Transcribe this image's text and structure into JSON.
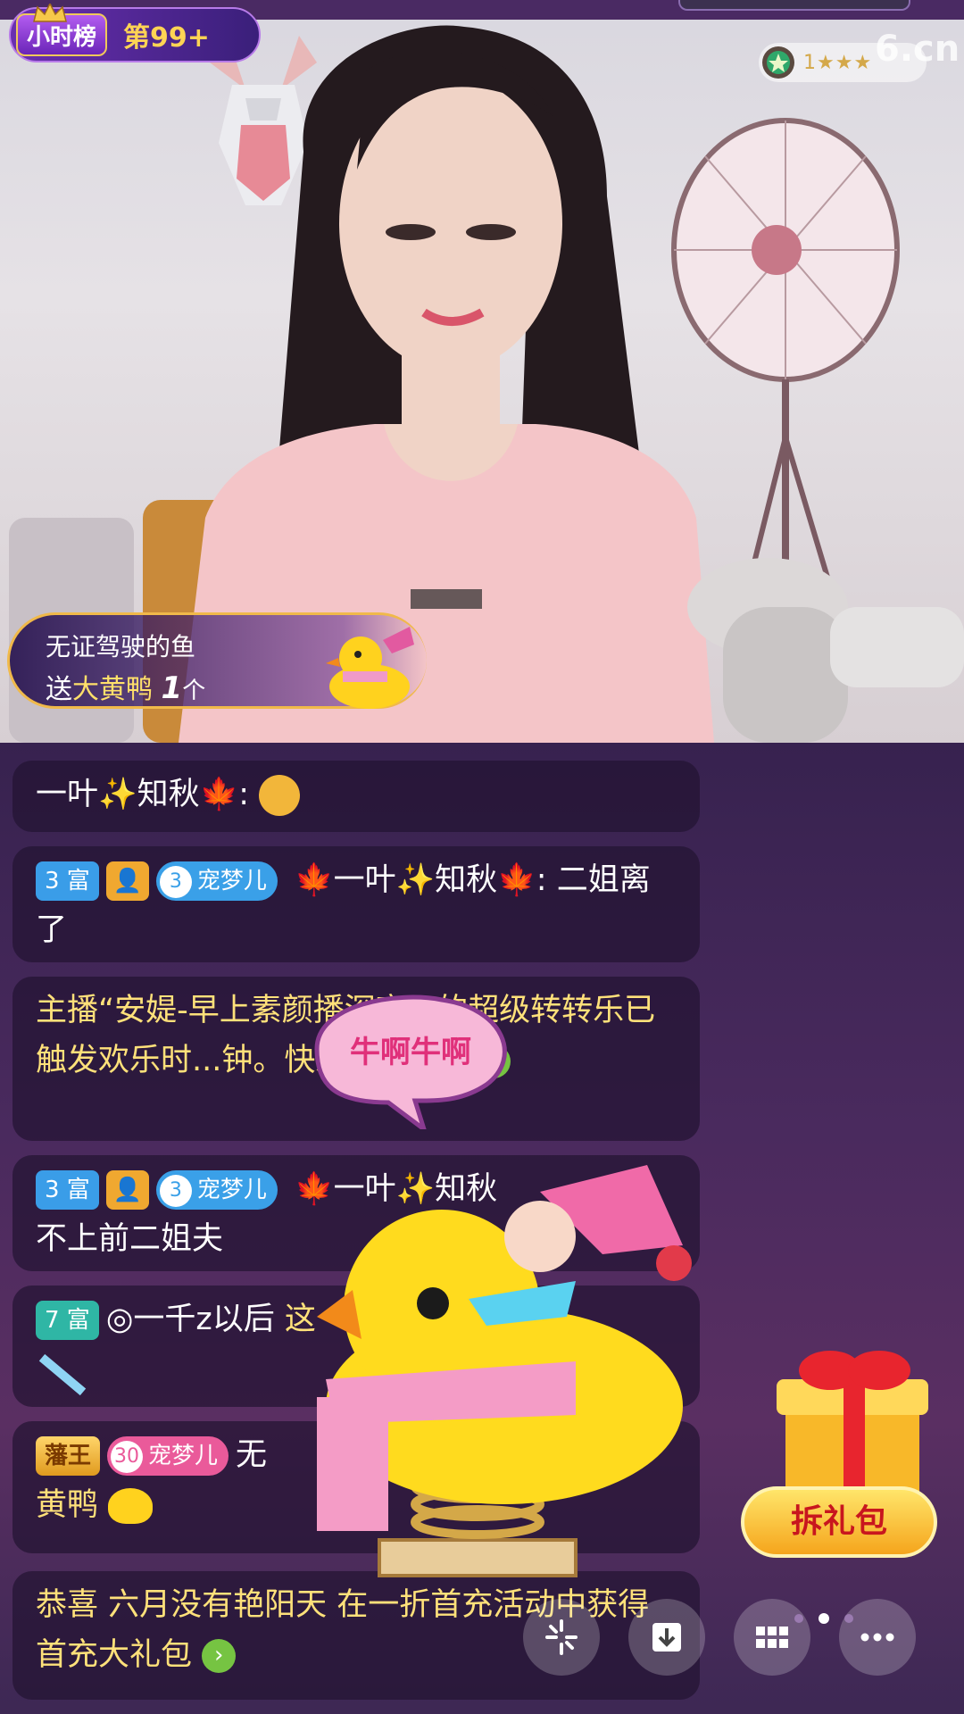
{
  "stream": {
    "hour_rank_label": "小时榜",
    "hour_rank_value": "第99+",
    "level_number": "1",
    "watermark": "6.cn"
  },
  "gift_banner": {
    "sender": "无证驾驶的鱼",
    "verb": "送",
    "gift_name": "大黄鸭",
    "count": "1",
    "unit": "个"
  },
  "chat": [
    {
      "user": "一叶",
      "user2": "知秋",
      "colon": ":"
    },
    {
      "rich": "3 富",
      "fan_level": "3",
      "fan_name": "宠梦儿",
      "user": "一叶",
      "user2": "知秋",
      "text": ": 二姐离了"
    },
    {
      "system": "主播“安媞-早上素颜播深夜...的超级转转乐已触发欢乐时...钟。快来参与吧~"
    },
    {
      "rich": "3 富",
      "fan_level": "3",
      "fan_name": "宠梦儿",
      "user": "一叶",
      "user2": "知秋",
      "text": "不上前二姐夫"
    },
    {
      "rich": "7 富",
      "user": "◎一千z以后",
      "text": "这"
    },
    {
      "lord": "藩王",
      "fan_level": "30",
      "fan_name": "宠梦儿",
      "text_prefix": "无",
      "text": "黄鸭"
    },
    {
      "system": "恭喜 六月没有艳阳天 在一折首充活动中获得首充大礼包"
    }
  ],
  "sticker_text": "牛啊牛啊",
  "gift_pack_label": "拆礼包",
  "toolbar": {
    "icons": [
      "sparkle-icon",
      "download-icon",
      "grid-icon",
      "more-icon"
    ]
  }
}
